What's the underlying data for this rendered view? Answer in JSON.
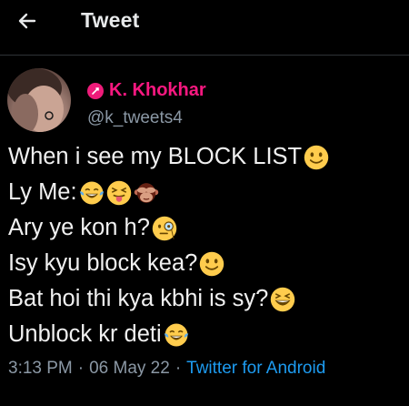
{
  "header": {
    "title": "Tweet",
    "back_icon": "arrow-left-icon"
  },
  "author": {
    "name": "K. Khokhar",
    "handle": "@k_tweets4",
    "name_color": "#f91880",
    "badge_icon": "pink-circle-icon"
  },
  "tweet": {
    "lines": [
      {
        "text": "When i see my BLOCK LIST",
        "emojis": [
          "slightly-smiling-face-icon"
        ]
      },
      {
        "text": "Ly Me:",
        "emojis": [
          "face-with-tears-of-joy-icon",
          "squinting-face-with-tongue-icon",
          "see-no-evil-monkey-icon"
        ]
      },
      {
        "text": "Ary ye kon h?",
        "emojis": [
          "face-with-monocle-icon"
        ]
      },
      {
        "text": "Isy kyu block kea?",
        "emojis": [
          "slightly-smiling-face-icon"
        ]
      },
      {
        "text": "Bat hoi thi kya kbhi is sy?",
        "emojis": [
          "grinning-squinting-face-icon"
        ]
      },
      {
        "text": "Unblock kr deti",
        "emojis": [
          "face-with-tears-of-joy-icon"
        ]
      }
    ]
  },
  "meta": {
    "time": "3:13 PM",
    "separator": "·",
    "date": "06 May 22",
    "source": "Twitter for Android",
    "link_color": "#1d9bf0"
  }
}
